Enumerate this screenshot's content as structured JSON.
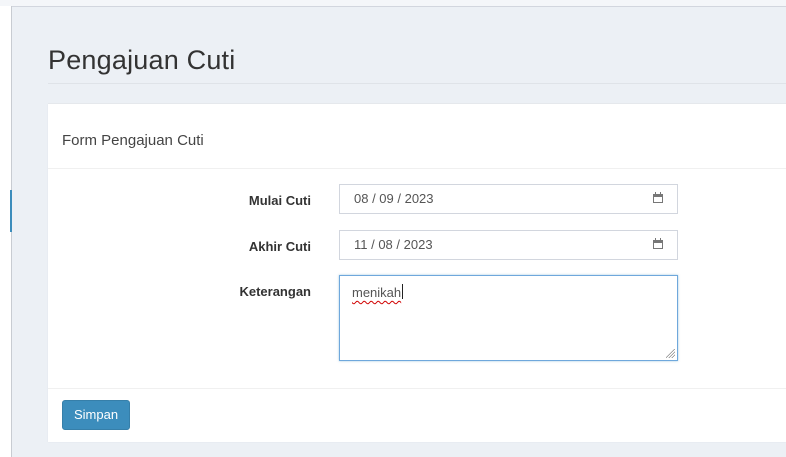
{
  "page": {
    "title": "Pengajuan Cuti"
  },
  "form": {
    "title": "Form Pengajuan Cuti",
    "fields": {
      "mulai_cuti": {
        "label": "Mulai Cuti",
        "value": "08 / 09 / 2023",
        "icon": "calendar-icon"
      },
      "akhir_cuti": {
        "label": "Akhir Cuti",
        "value": "11 / 08 / 2023",
        "icon": "calendar-icon"
      },
      "keterangan": {
        "label": "Keterangan",
        "value": "menikah"
      }
    },
    "submit_label": "Simpan"
  },
  "colors": {
    "background": "#ecf0f5",
    "primary_button": "#3c8dbc",
    "focus_border": "#6fa8dc"
  }
}
